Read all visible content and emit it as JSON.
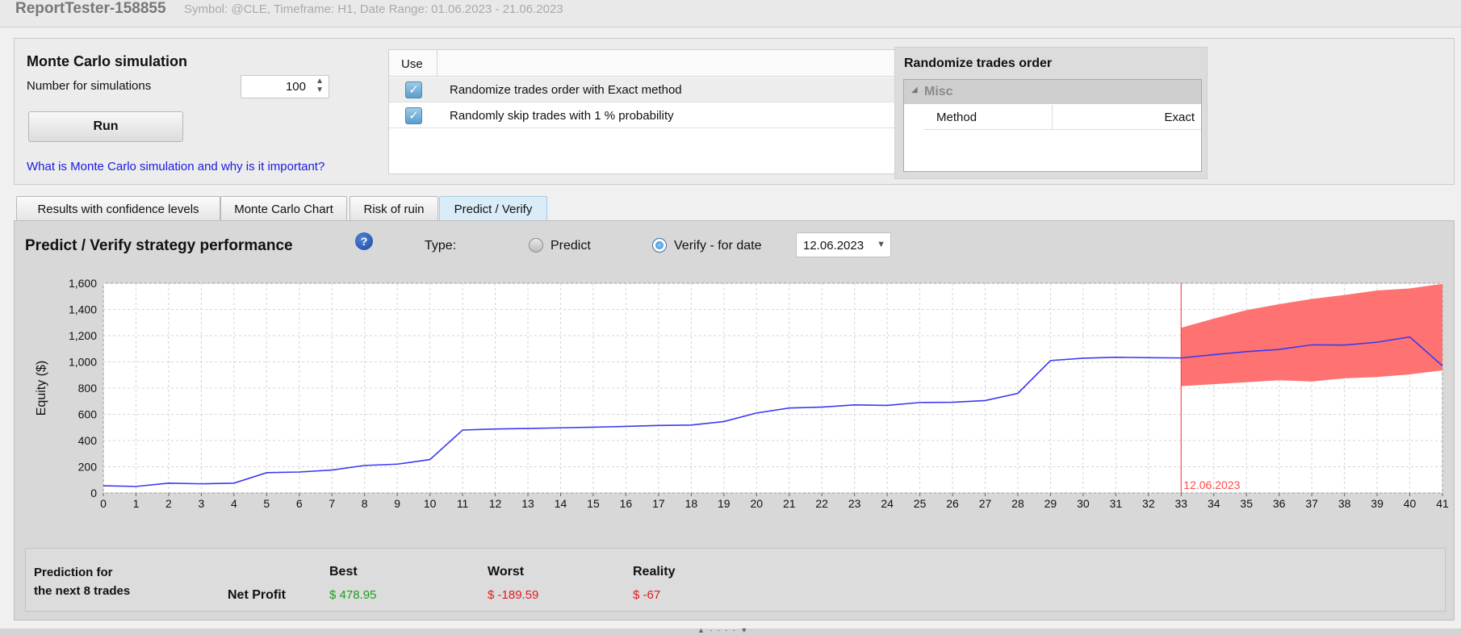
{
  "window": {
    "title": "ReportTester-158855",
    "subtitle": "Symbol: @CLE, Timeframe: H1, Date Range: 01.06.2023 - 21.06.2023"
  },
  "monte_carlo": {
    "title": "Monte Carlo simulation",
    "sim_label": "Number for simulations",
    "sim_value": "100",
    "run_label": "Run",
    "help_link": "What is Monte Carlo simulation and why is it important?"
  },
  "use_table": {
    "header": "Use",
    "rows": [
      {
        "checked": true,
        "label": "Randomize trades order with Exact method"
      },
      {
        "checked": true,
        "label": "Randomly skip trades with 1 % probability"
      }
    ]
  },
  "randomize": {
    "title": "Randomize trades order",
    "category": "Misc",
    "property_name": "Method",
    "property_value": "Exact"
  },
  "tabs": [
    {
      "label": "Results with confidence levels",
      "active": false
    },
    {
      "label": "Monte Carlo Chart",
      "active": false
    },
    {
      "label": "Risk of ruin",
      "active": false
    },
    {
      "label": "Predict / Verify",
      "active": true
    }
  ],
  "predict_verify": {
    "title": "Predict / Verify strategy performance",
    "help_icon": "?",
    "type_label": "Type:",
    "option_predict": "Predict",
    "option_verify": "Verify - for date",
    "selected_option": "verify",
    "date_value": "12.06.2023"
  },
  "chart_data": {
    "type": "line",
    "ylabel": "Equity ($)",
    "xlabel": "",
    "xlim": [
      0,
      41
    ],
    "ylim": [
      0,
      1600
    ],
    "ytick_step": 200,
    "grid": true,
    "x": [
      0,
      1,
      2,
      3,
      4,
      5,
      6,
      7,
      8,
      9,
      10,
      11,
      12,
      13,
      14,
      15,
      16,
      17,
      18,
      19,
      20,
      21,
      22,
      23,
      24,
      25,
      26,
      27,
      28,
      29,
      30,
      31,
      32,
      33,
      34,
      35,
      36,
      37,
      38,
      39,
      40,
      41
    ],
    "series": [
      {
        "name": "",
        "color": "#3a3af0",
        "values": [
          55,
          50,
          75,
          70,
          75,
          155,
          160,
          175,
          210,
          220,
          255,
          480,
          488,
          492,
          497,
          502,
          508,
          515,
          518,
          545,
          610,
          648,
          655,
          672,
          668,
          690,
          692,
          705,
          760,
          1010,
          1028,
          1035,
          1032,
          1030,
          1055,
          1078,
          1095,
          1130,
          1128,
          1150,
          1190,
          970
        ]
      }
    ],
    "band": {
      "color": "#ff6a6a",
      "x": [
        33,
        34,
        35,
        36,
        37,
        38,
        39,
        40,
        41
      ],
      "upper": [
        1260,
        1330,
        1395,
        1440,
        1480,
        1510,
        1545,
        1560,
        1595
      ],
      "lower": [
        815,
        830,
        845,
        860,
        850,
        875,
        885,
        905,
        935
      ]
    },
    "marker": {
      "x": 33,
      "label": "12.06.2023",
      "color": "#ff4a4a"
    }
  },
  "prediction": {
    "label_line1": "Prediction for",
    "label_line2": "the next 8 trades",
    "row_label": "Net Profit",
    "best_header": "Best",
    "worst_header": "Worst",
    "reality_header": "Reality",
    "best_value": "$ 478.95",
    "worst_value": "$ -189.59",
    "reality_value": "$ -67"
  },
  "colors": {
    "best": "#1f9a1f",
    "worst": "#e01b1b",
    "reality": "#e01b1b",
    "link": "#1a1ae0"
  }
}
